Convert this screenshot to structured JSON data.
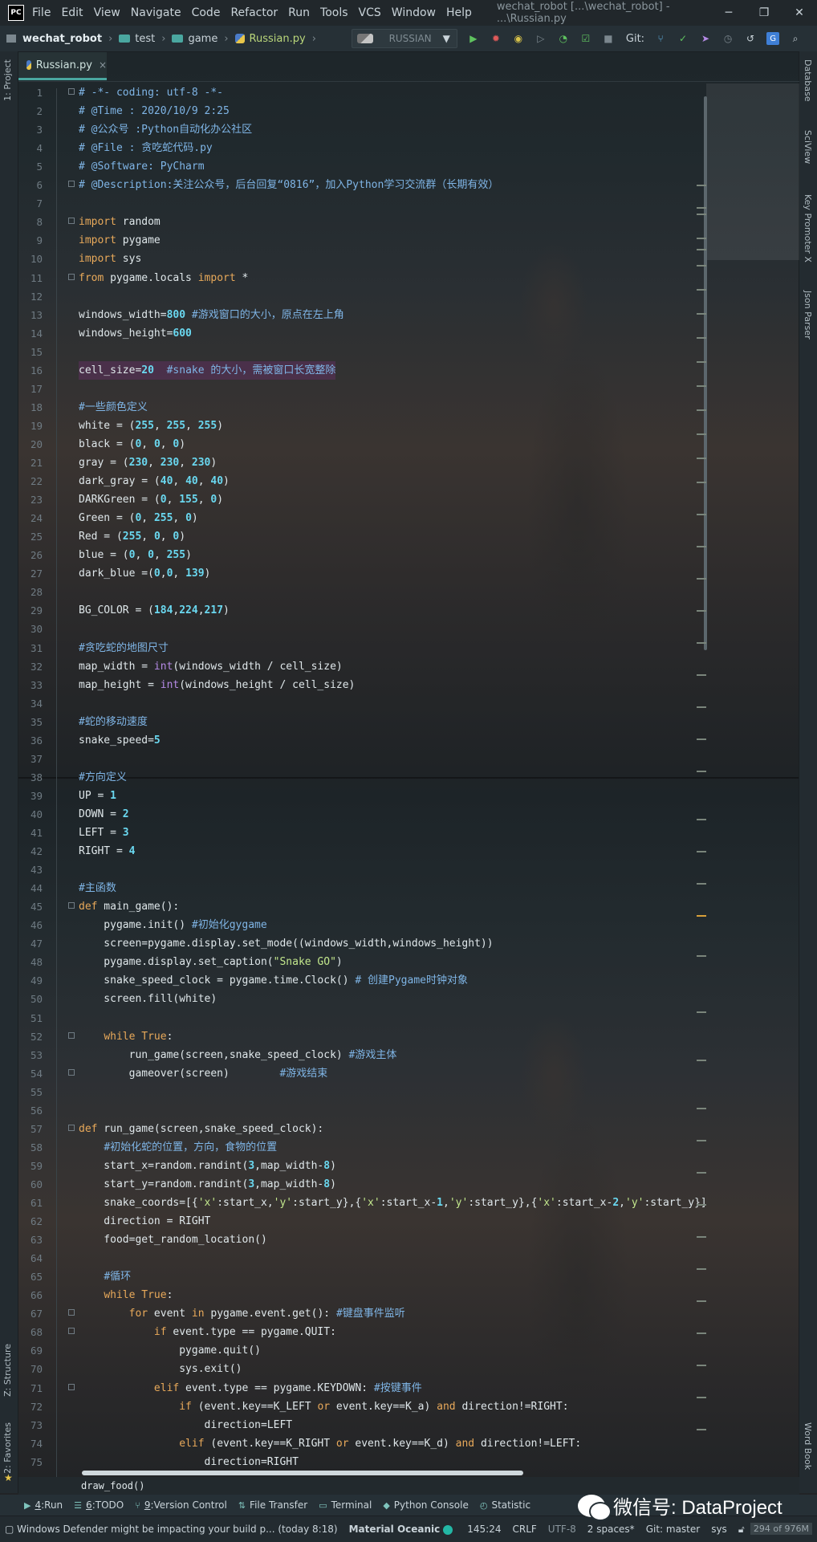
{
  "window": {
    "menu": [
      "File",
      "Edit",
      "View",
      "Navigate",
      "Code",
      "Refactor",
      "Run",
      "Tools",
      "VCS",
      "Window",
      "Help"
    ],
    "title": "wechat_robot [...\\wechat_robot] - ...\\Russian.py",
    "minimize": "─",
    "restore": "❐",
    "close": "✕"
  },
  "navbar": {
    "project": "wechat_robot",
    "crumbs": [
      "test",
      "game",
      "Russian.py"
    ],
    "run_config": "RUSSIAN",
    "git_label": "Git:"
  },
  "left_tabs": {
    "project": "1: Project",
    "structure": "Z: Structure",
    "favorites": "2: Favorites"
  },
  "right_tabs": {
    "database": "Database",
    "sciview": "SciView",
    "key_promoter": "Key Promoter X",
    "json_parser": "Json Parser",
    "word_book": "Word Book"
  },
  "editor_tab": {
    "name": "Russian.py",
    "close": "×"
  },
  "code_lines": [
    "# -*- coding: utf-8 -*-",
    "# @Time : 2020/10/9 2:25",
    "# @公众号 :Python自动化办公社区",
    "# @File : 贪吃蛇代码.py",
    "# @Software: PyCharm",
    "# @Description:关注公众号，后台回复“0816”，加入Python学习交流群（长期有效）",
    "",
    "import random",
    "import pygame",
    "import sys",
    "from pygame.locals import *",
    "",
    "windows_width=800 #游戏窗口的大小，原点在左上角",
    "windows_height=600",
    "",
    "cell_size=20  #snake 的大小，需被窗口长宽整除",
    "",
    "#一些颜色定义",
    "white = (255, 255, 255)",
    "black = (0, 0, 0)",
    "gray = (230, 230, 230)",
    "dark_gray = (40, 40, 40)",
    "DARKGreen = (0, 155, 0)",
    "Green = (0, 255, 0)",
    "Red = (255, 0, 0)",
    "blue = (0, 0, 255)",
    "dark_blue =(0,0, 139)",
    "",
    "BG_COLOR = (184,224,217)",
    "",
    "#贪吃蛇的地图尺寸",
    "map_width = int(windows_width / cell_size)",
    "map_height = int(windows_height / cell_size)",
    "",
    "#蛇的移动速度",
    "snake_speed=5",
    "",
    "#方向定义",
    "UP = 1",
    "DOWN = 2",
    "LEFT = 3",
    "RIGHT = 4",
    "",
    "#主函数",
    "def main_game():",
    "    pygame.init() #初始化gygame",
    "    screen=pygame.display.set_mode((windows_width,windows_height))",
    "    pygame.display.set_caption(\"Snake GO\")",
    "    snake_speed_clock = pygame.time.Clock() # 创建Pygame时钟对象",
    "    screen.fill(white)",
    "",
    "    while True:",
    "        run_game(screen,snake_speed_clock) #游戏主体",
    "        gameover(screen)        #游戏结束",
    "",
    "",
    "def run_game(screen,snake_speed_clock):",
    "    #初始化蛇的位置，方向，食物的位置",
    "    start_x=random.randint(3,map_width-8)",
    "    start_y=random.randint(3,map_width-8)",
    "    snake_coords=[{'x':start_x,'y':start_y},{'x':start_x-1,'y':start_y},{'x':start_x-2,'y':start_y}]",
    "    direction = RIGHT",
    "    food=get_random_location()",
    "",
    "    #循环",
    "    while True:",
    "        for event in pygame.event.get(): #键盘事件监听",
    "            if event.type == pygame.QUIT:",
    "                pygame.quit()",
    "                sys.exit()",
    "            elif event.type == pygame.KEYDOWN: #按键事件",
    "                if (event.key==K_LEFT or event.key==K_a) and direction!=RIGHT:",
    "                    direction=LEFT",
    "                elif (event.key==K_RIGHT or event.key==K_d) and direction!=LEFT:",
    "                    direction=RIGHT"
  ],
  "breadcrumb_bottom": "draw_food()",
  "tool_windows": [
    {
      "num": "4",
      "label": "Run"
    },
    {
      "num": "6",
      "label": "TODO"
    },
    {
      "num": "9",
      "label": "Version Control"
    },
    {
      "num": "",
      "label": "File Transfer"
    },
    {
      "num": "",
      "label": "Terminal"
    },
    {
      "num": "",
      "label": "Python Console"
    },
    {
      "num": "",
      "label": "Statistic"
    }
  ],
  "watermark": "微信号: DataProject",
  "status": {
    "message": "Windows Defender might be impacting your build p... (today 8:18)",
    "theme": "Material Oceanic",
    "position": "145:24",
    "line_sep": "CRLF",
    "encoding": "UTF-8",
    "indent": "2 spaces*",
    "branch": "Git: master",
    "interpreter": "sys",
    "memory": "294 of 976M"
  },
  "colors": {
    "accent": "#4aa7a0",
    "keyword": "#e8a95a",
    "number": "#6ad8f0",
    "comment": "#7fb5e6",
    "string": "#c3e88d"
  }
}
